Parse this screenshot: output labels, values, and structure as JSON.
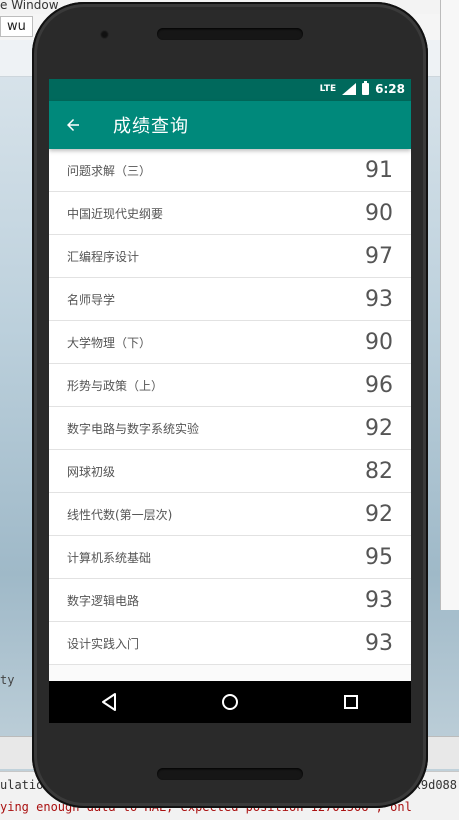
{
  "desktop": {
    "ide_menu": "e Window",
    "ide_tab": "wu",
    "ide_left_text": "ty",
    "log_line_1": "ulation",
    "log_line_1_right": "x9d088",
    "log_line_2": "ying enough data to HAL, expected position 12701506 , onl"
  },
  "status": {
    "network": "LTE",
    "time": "6:28"
  },
  "appbar": {
    "title": "成绩查询"
  },
  "grades": [
    {
      "course": "问题求解（三）",
      "score": "91"
    },
    {
      "course": "中国近现代史纲要",
      "score": "90"
    },
    {
      "course": "汇编程序设计",
      "score": "97"
    },
    {
      "course": "名师导学",
      "score": "93"
    },
    {
      "course": "大学物理（下）",
      "score": "90"
    },
    {
      "course": "形势与政策（上）",
      "score": "96"
    },
    {
      "course": "数字电路与数字系统实验",
      "score": "92"
    },
    {
      "course": "网球初级",
      "score": "82"
    },
    {
      "course": "线性代数(第一层次)",
      "score": "92"
    },
    {
      "course": "计算机系统基础",
      "score": "95"
    },
    {
      "course": "数字逻辑电路",
      "score": "93"
    },
    {
      "course": "设计实践入门",
      "score": "93"
    }
  ],
  "icons": {
    "back": "arrow-back-icon",
    "nav_back": "triangle-back-icon",
    "nav_home": "circle-home-icon",
    "nav_recents": "square-recents-icon"
  },
  "colors": {
    "status_bar": "#00695c",
    "app_bar": "#00897b"
  }
}
